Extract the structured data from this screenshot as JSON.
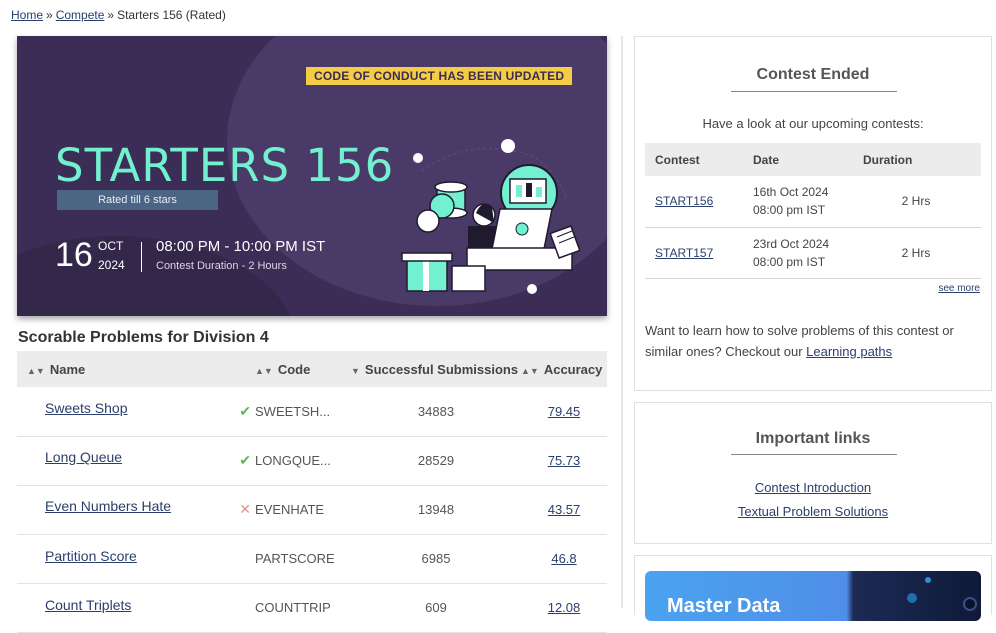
{
  "breadcrumb": {
    "home": "Home",
    "compete": "Compete",
    "current": "Starters 156 (Rated)",
    "sep": "»"
  },
  "banner": {
    "notice": "CODE OF CONDUCT HAS BEEN UPDATED",
    "title": "STARTERS 156",
    "rated": "Rated till 6 stars",
    "day": "16",
    "month": "OCT",
    "year": "2024",
    "time": "08:00 PM - 10:00 PM IST",
    "duration": "Contest Duration - 2 Hours",
    "colors": {
      "bg": "#3b2d55",
      "title": "#73f0cf",
      "notice": "#f4cc45"
    }
  },
  "problems": {
    "heading": "Scorable Problems for Division 4",
    "columns": {
      "name": "Name",
      "code": "Code",
      "subs": "Successful Submissions",
      "acc": "Accuracy"
    },
    "rows": [
      {
        "name": "Sweets Shop",
        "status": "solved",
        "status_icon": "✔",
        "code": "SWEETSH...",
        "subs": "34883",
        "acc": "79.45"
      },
      {
        "name": "Long Queue",
        "status": "solved",
        "status_icon": "✔",
        "code": "LONGQUE...",
        "subs": "28529",
        "acc": "75.73"
      },
      {
        "name": "Even Numbers Hate",
        "status": "wrong",
        "status_icon": "✕",
        "code": "EVENHATE",
        "subs": "13948",
        "acc": "43.57"
      },
      {
        "name": "Partition Score",
        "status": "",
        "status_icon": "",
        "code": "PARTSCORE",
        "subs": "6985",
        "acc": "46.8"
      },
      {
        "name": "Count Triplets",
        "status": "",
        "status_icon": "",
        "code": "COUNTTRIP",
        "subs": "609",
        "acc": "12.08"
      }
    ]
  },
  "contest_card": {
    "heading": "Contest Ended",
    "upcoming": "Have a look at our upcoming contests:",
    "columns": {
      "contest": "Contest",
      "date": "Date",
      "duration": "Duration"
    },
    "rows": [
      {
        "contest": "START156",
        "date": "16th Oct 2024",
        "time": "08:00 pm IST",
        "duration": "2 Hrs"
      },
      {
        "contest": "START157",
        "date": "23rd Oct 2024",
        "time": "08:00 pm IST",
        "duration": "2 Hrs"
      }
    ],
    "see_more": "see more",
    "learn_text": "Want to learn how to solve problems of this contest or similar ones? Checkout our ",
    "learn_link": "Learning paths"
  },
  "links_card": {
    "heading": "Important links",
    "links": [
      "Contest Introduction",
      "Textual Problem Solutions"
    ]
  },
  "ad": {
    "text": "Master Data"
  }
}
